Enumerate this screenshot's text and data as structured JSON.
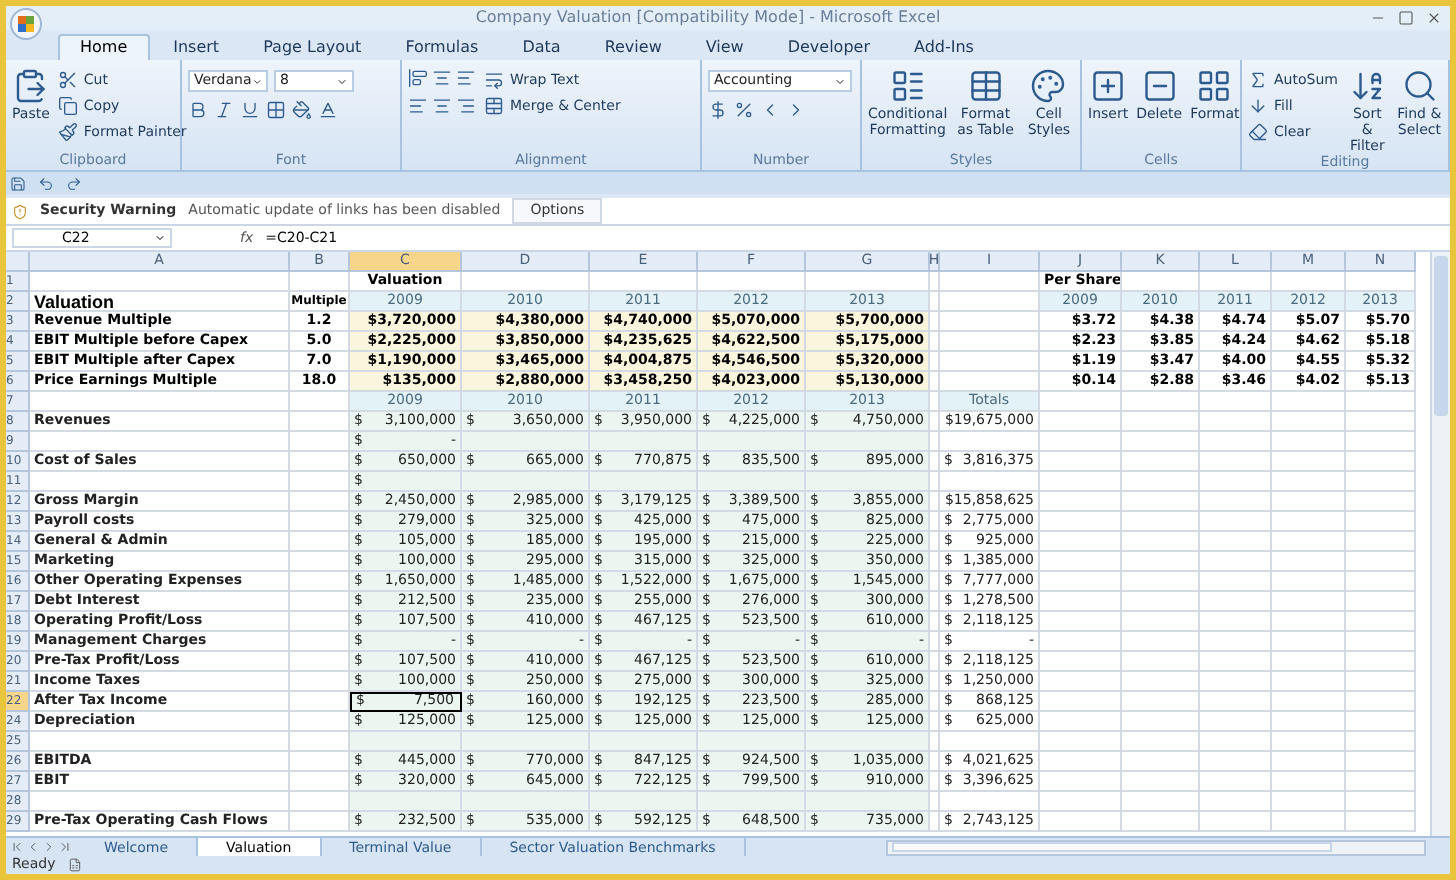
{
  "window": {
    "title": "Company Valuation  [Compatibility Mode] - Microsoft Excel"
  },
  "ribbon_tabs": [
    {
      "label": "Home",
      "selected": true
    },
    {
      "label": "Insert",
      "selected": false
    },
    {
      "label": "Page Layout",
      "selected": false
    },
    {
      "label": "Formulas",
      "selected": false
    },
    {
      "label": "Data",
      "selected": false
    },
    {
      "label": "Review",
      "selected": false
    },
    {
      "label": "View",
      "selected": false
    },
    {
      "label": "Developer",
      "selected": false
    },
    {
      "label": "Add-Ins",
      "selected": false
    }
  ],
  "ribbon": {
    "groups": [
      {
        "label": "Clipboard",
        "items": [
          {
            "kind": "large",
            "label": "Paste"
          },
          {
            "kind": "small",
            "label": "Cut"
          },
          {
            "kind": "small",
            "label": "Copy"
          },
          {
            "kind": "small",
            "label": "Format Painter"
          }
        ]
      },
      {
        "label": "Font",
        "items": [
          {
            "kind": "field",
            "value": "Verdana"
          },
          {
            "kind": "field",
            "value": "8"
          }
        ]
      },
      {
        "label": "Alignment",
        "items": [
          {
            "kind": "small",
            "label": "Wrap Text"
          },
          {
            "kind": "small",
            "label": "Merge & Center"
          }
        ]
      },
      {
        "label": "Number",
        "items": [
          {
            "kind": "field",
            "value": "Accounting"
          }
        ]
      },
      {
        "label": "Styles",
        "items": [
          {
            "kind": "large",
            "label": "Conditional Formatting"
          },
          {
            "kind": "large",
            "label": "Format as Table"
          },
          {
            "kind": "large",
            "label": "Cell Styles"
          }
        ]
      },
      {
        "label": "Cells",
        "items": [
          {
            "kind": "large",
            "label": "Insert"
          },
          {
            "kind": "large",
            "label": "Delete"
          },
          {
            "kind": "large",
            "label": "Format"
          }
        ]
      },
      {
        "label": "Editing",
        "items": [
          {
            "kind": "small",
            "label": "AutoSum"
          },
          {
            "kind": "small",
            "label": "Fill"
          },
          {
            "kind": "small",
            "label": "Clear"
          },
          {
            "kind": "large",
            "label": "Sort & Filter"
          },
          {
            "kind": "large",
            "label": "Find & Select"
          }
        ]
      }
    ]
  },
  "security_bar": {
    "title": "Security Warning",
    "message": "Automatic update of links has been disabled",
    "button": "Options"
  },
  "formula_bar": {
    "name_box": "C22",
    "fx": "fx",
    "formula": "=C20-C21"
  },
  "table": {
    "columns": [
      {
        "label": "A",
        "selected": false
      },
      {
        "label": "B",
        "selected": false
      },
      {
        "label": "C",
        "selected": true
      },
      {
        "label": "D",
        "selected": false
      },
      {
        "label": "E",
        "selected": false
      },
      {
        "label": "F",
        "selected": false
      },
      {
        "label": "G",
        "selected": false
      },
      {
        "label": "H",
        "selected": false
      },
      {
        "label": "I",
        "selected": false
      },
      {
        "label": "J",
        "selected": false
      },
      {
        "label": "K",
        "selected": false
      },
      {
        "label": "L",
        "selected": false
      },
      {
        "label": "M",
        "selected": false
      },
      {
        "label": "N",
        "selected": false
      }
    ],
    "rows": [
      {
        "num": "1",
        "kind": "heading",
        "selected": false,
        "c": "Valuation",
        "j": "Per Share"
      },
      {
        "num": "2",
        "kind": "title",
        "selected": false,
        "a": "Valuation",
        "b": "Multiple",
        "c": "2009",
        "d": "2010",
        "e": "2011",
        "f": "2012",
        "g": "2013",
        "j": "2009",
        "k": "2010",
        "l": "2011",
        "m": "2012",
        "n": "2013"
      },
      {
        "num": "3",
        "kind": "multiple",
        "selected": false,
        "a": "Revenue Multiple",
        "b": "1.2",
        "c": "$3,720,000",
        "d": "$4,380,000",
        "e": "$4,740,000",
        "f": "$5,070,000",
        "g": "$5,700,000",
        "j": "$3.72",
        "k": "$4.38",
        "l": "$4.74",
        "m": "$5.07",
        "n": "$5.70"
      },
      {
        "num": "4",
        "kind": "multiple",
        "selected": false,
        "a": "EBIT Multiple before Capex",
        "b": "5.0",
        "c": "$2,225,000",
        "d": "$3,850,000",
        "e": "$4,235,625",
        "f": "$4,622,500",
        "g": "$5,175,000",
        "j": "$2.23",
        "k": "$3.85",
        "l": "$4.24",
        "m": "$4.62",
        "n": "$5.18"
      },
      {
        "num": "5",
        "kind": "multiple",
        "selected": false,
        "a": "EBIT Multiple after Capex",
        "b": "7.0",
        "c": "$1,190,000",
        "d": "$3,465,000",
        "e": "$4,004,875",
        "f": "$4,546,500",
        "g": "$5,320,000",
        "j": "$1.19",
        "k": "$3.47",
        "l": "$4.00",
        "m": "$4.55",
        "n": "$5.32"
      },
      {
        "num": "6",
        "kind": "multiple",
        "selected": false,
        "a": "Price Earnings Multiple",
        "b": "18.0",
        "c": "$135,000",
        "d": "$2,880,000",
        "e": "$3,458,250",
        "f": "$4,023,000",
        "g": "$5,130,000",
        "j": "$0.14",
        "k": "$2.88",
        "l": "$3.46",
        "m": "$4.02",
        "n": "$5.13"
      },
      {
        "num": "7",
        "kind": "years",
        "selected": false,
        "c": "2009",
        "d": "2010",
        "e": "2011",
        "f": "2012",
        "g": "2013",
        "i": "Totals"
      },
      {
        "num": "8",
        "kind": "amounts",
        "selected": false,
        "a": "Revenues",
        "c": [
          "$",
          "3,100,000"
        ],
        "d": [
          "$",
          "3,650,000"
        ],
        "e": [
          "$",
          "3,950,000"
        ],
        "f": [
          "$",
          "4,225,000"
        ],
        "g": [
          "$",
          "4,750,000"
        ],
        "i": "$19,675,000"
      },
      {
        "num": "9",
        "kind": "amounts",
        "selected": false,
        "c": [
          "$",
          "-"
        ]
      },
      {
        "num": "10",
        "kind": "amounts",
        "selected": false,
        "a": "Cost of Sales",
        "c": [
          "$",
          "650,000"
        ],
        "d": [
          "$",
          "665,000"
        ],
        "e": [
          "$",
          "770,875"
        ],
        "f": [
          "$",
          "835,500"
        ],
        "g": [
          "$",
          "895,000"
        ],
        "i": [
          "$",
          "3,816,375"
        ]
      },
      {
        "num": "11",
        "kind": "amounts",
        "selected": false,
        "c": [
          "$"
        ]
      },
      {
        "num": "12",
        "kind": "amounts",
        "selected": false,
        "a": "Gross Margin",
        "c": [
          "$",
          "2,450,000"
        ],
        "d": [
          "$",
          "2,985,000"
        ],
        "e": [
          "$",
          "3,179,125"
        ],
        "f": [
          "$",
          "3,389,500"
        ],
        "g": [
          "$",
          "3,855,000"
        ],
        "i": "$15,858,625"
      },
      {
        "num": "13",
        "kind": "amounts",
        "selected": false,
        "a": "Payroll costs",
        "c": [
          "$",
          "279,000"
        ],
        "d": [
          "$",
          "325,000"
        ],
        "e": [
          "$",
          "425,000"
        ],
        "f": [
          "$",
          "475,000"
        ],
        "g": [
          "$",
          "825,000"
        ],
        "i": [
          "$",
          "2,775,000"
        ]
      },
      {
        "num": "14",
        "kind": "amounts",
        "selected": false,
        "a": "General & Admin",
        "c": [
          "$",
          "105,000"
        ],
        "d": [
          "$",
          "185,000"
        ],
        "e": [
          "$",
          "195,000"
        ],
        "f": [
          "$",
          "215,000"
        ],
        "g": [
          "$",
          "225,000"
        ],
        "i": [
          "$",
          "925,000"
        ]
      },
      {
        "num": "15",
        "kind": "amounts",
        "selected": false,
        "a": "Marketing",
        "c": [
          "$",
          "100,000"
        ],
        "d": [
          "$",
          "295,000"
        ],
        "e": [
          "$",
          "315,000"
        ],
        "f": [
          "$",
          "325,000"
        ],
        "g": [
          "$",
          "350,000"
        ],
        "i": [
          "$",
          "1,385,000"
        ]
      },
      {
        "num": "16",
        "kind": "amounts",
        "selected": false,
        "a": "Other Operating Expenses",
        "c": [
          "$",
          "1,650,000"
        ],
        "d": [
          "$",
          "1,485,000"
        ],
        "e": [
          "$",
          "1,522,000"
        ],
        "f": [
          "$",
          "1,675,000"
        ],
        "g": [
          "$",
          "1,545,000"
        ],
        "i": [
          "$",
          "7,777,000"
        ]
      },
      {
        "num": "17",
        "kind": "amounts",
        "selected": false,
        "a": "Debt Interest",
        "c": [
          "$",
          "212,500"
        ],
        "d": [
          "$",
          "235,000"
        ],
        "e": [
          "$",
          "255,000"
        ],
        "f": [
          "$",
          "276,000"
        ],
        "g": [
          "$",
          "300,000"
        ],
        "i": [
          "$",
          "1,278,500"
        ]
      },
      {
        "num": "18",
        "kind": "amounts",
        "selected": false,
        "a": "Operating Profit/Loss",
        "c": [
          "$",
          "107,500"
        ],
        "d": [
          "$",
          "410,000"
        ],
        "e": [
          "$",
          "467,125"
        ],
        "f": [
          "$",
          "523,500"
        ],
        "g": [
          "$",
          "610,000"
        ],
        "i": [
          "$",
          "2,118,125"
        ]
      },
      {
        "num": "19",
        "kind": "amounts",
        "selected": false,
        "a": "Management Charges",
        "c": [
          "$",
          "-"
        ],
        "d": [
          "$",
          "-"
        ],
        "e": [
          "$",
          "-"
        ],
        "f": [
          "$",
          "-"
        ],
        "g": [
          "$",
          "-"
        ],
        "i": [
          "$",
          "-"
        ]
      },
      {
        "num": "20",
        "kind": "amounts",
        "selected": false,
        "a": "Pre-Tax Profit/Loss",
        "c": [
          "$",
          "107,500"
        ],
        "d": [
          "$",
          "410,000"
        ],
        "e": [
          "$",
          "467,125"
        ],
        "f": [
          "$",
          "523,500"
        ],
        "g": [
          "$",
          "610,000"
        ],
        "i": [
          "$",
          "2,118,125"
        ]
      },
      {
        "num": "21",
        "kind": "amounts",
        "selected": false,
        "a": "Income Taxes",
        "c": [
          "$",
          "100,000"
        ],
        "d": [
          "$",
          "250,000"
        ],
        "e": [
          "$",
          "275,000"
        ],
        "f": [
          "$",
          "300,000"
        ],
        "g": [
          "$",
          "325,000"
        ],
        "i": [
          "$",
          "1,250,000"
        ]
      },
      {
        "num": "22",
        "kind": "amounts",
        "selected": true,
        "a": "After Tax Income",
        "c": [
          "$",
          "7,500"
        ],
        "d": [
          "$",
          "160,000"
        ],
        "e": [
          "$",
          "192,125"
        ],
        "f": [
          "$",
          "223,500"
        ],
        "g": [
          "$",
          "285,000"
        ],
        "i": [
          "$",
          "868,125"
        ]
      },
      {
        "num": "24",
        "kind": "amounts",
        "selected": false,
        "a": "Depreciation",
        "c": [
          "$",
          "125,000"
        ],
        "d": [
          "$",
          "125,000"
        ],
        "e": [
          "$",
          "125,000"
        ],
        "f": [
          "$",
          "125,000"
        ],
        "g": [
          "$",
          "125,000"
        ],
        "i": [
          "$",
          "625,000"
        ]
      },
      {
        "num": "25",
        "kind": "amounts",
        "selected": false
      },
      {
        "num": "26",
        "kind": "amounts",
        "selected": false,
        "a": "EBITDA",
        "c": [
          "$",
          "445,000"
        ],
        "d": [
          "$",
          "770,000"
        ],
        "e": [
          "$",
          "847,125"
        ],
        "f": [
          "$",
          "924,500"
        ],
        "g": [
          "$",
          "1,035,000"
        ],
        "i": [
          "$",
          "4,021,625"
        ]
      },
      {
        "num": "27",
        "kind": "amounts",
        "selected": false,
        "a": "EBIT",
        "c": [
          "$",
          "320,000"
        ],
        "d": [
          "$",
          "645,000"
        ],
        "e": [
          "$",
          "722,125"
        ],
        "f": [
          "$",
          "799,500"
        ],
        "g": [
          "$",
          "910,000"
        ],
        "i": [
          "$",
          "3,396,625"
        ]
      },
      {
        "num": "28",
        "kind": "amounts",
        "selected": false
      },
      {
        "num": "29",
        "kind": "amounts",
        "selected": false,
        "a": "Pre-Tax Operating Cash Flows",
        "c": [
          "$",
          "232,500"
        ],
        "d": [
          "$",
          "535,000"
        ],
        "e": [
          "$",
          "592,125"
        ],
        "f": [
          "$",
          "648,500"
        ],
        "g": [
          "$",
          "735,000"
        ],
        "i": [
          "$",
          "2,743,125"
        ]
      }
    ]
  },
  "sheet_tabs": [
    {
      "label": "Welcome",
      "selected": false
    },
    {
      "label": "Valuation",
      "selected": true
    },
    {
      "label": "Terminal Value",
      "selected": false
    },
    {
      "label": "Sector Valuation Benchmarks",
      "selected": false
    }
  ],
  "status_bar": {
    "text": "Ready"
  }
}
